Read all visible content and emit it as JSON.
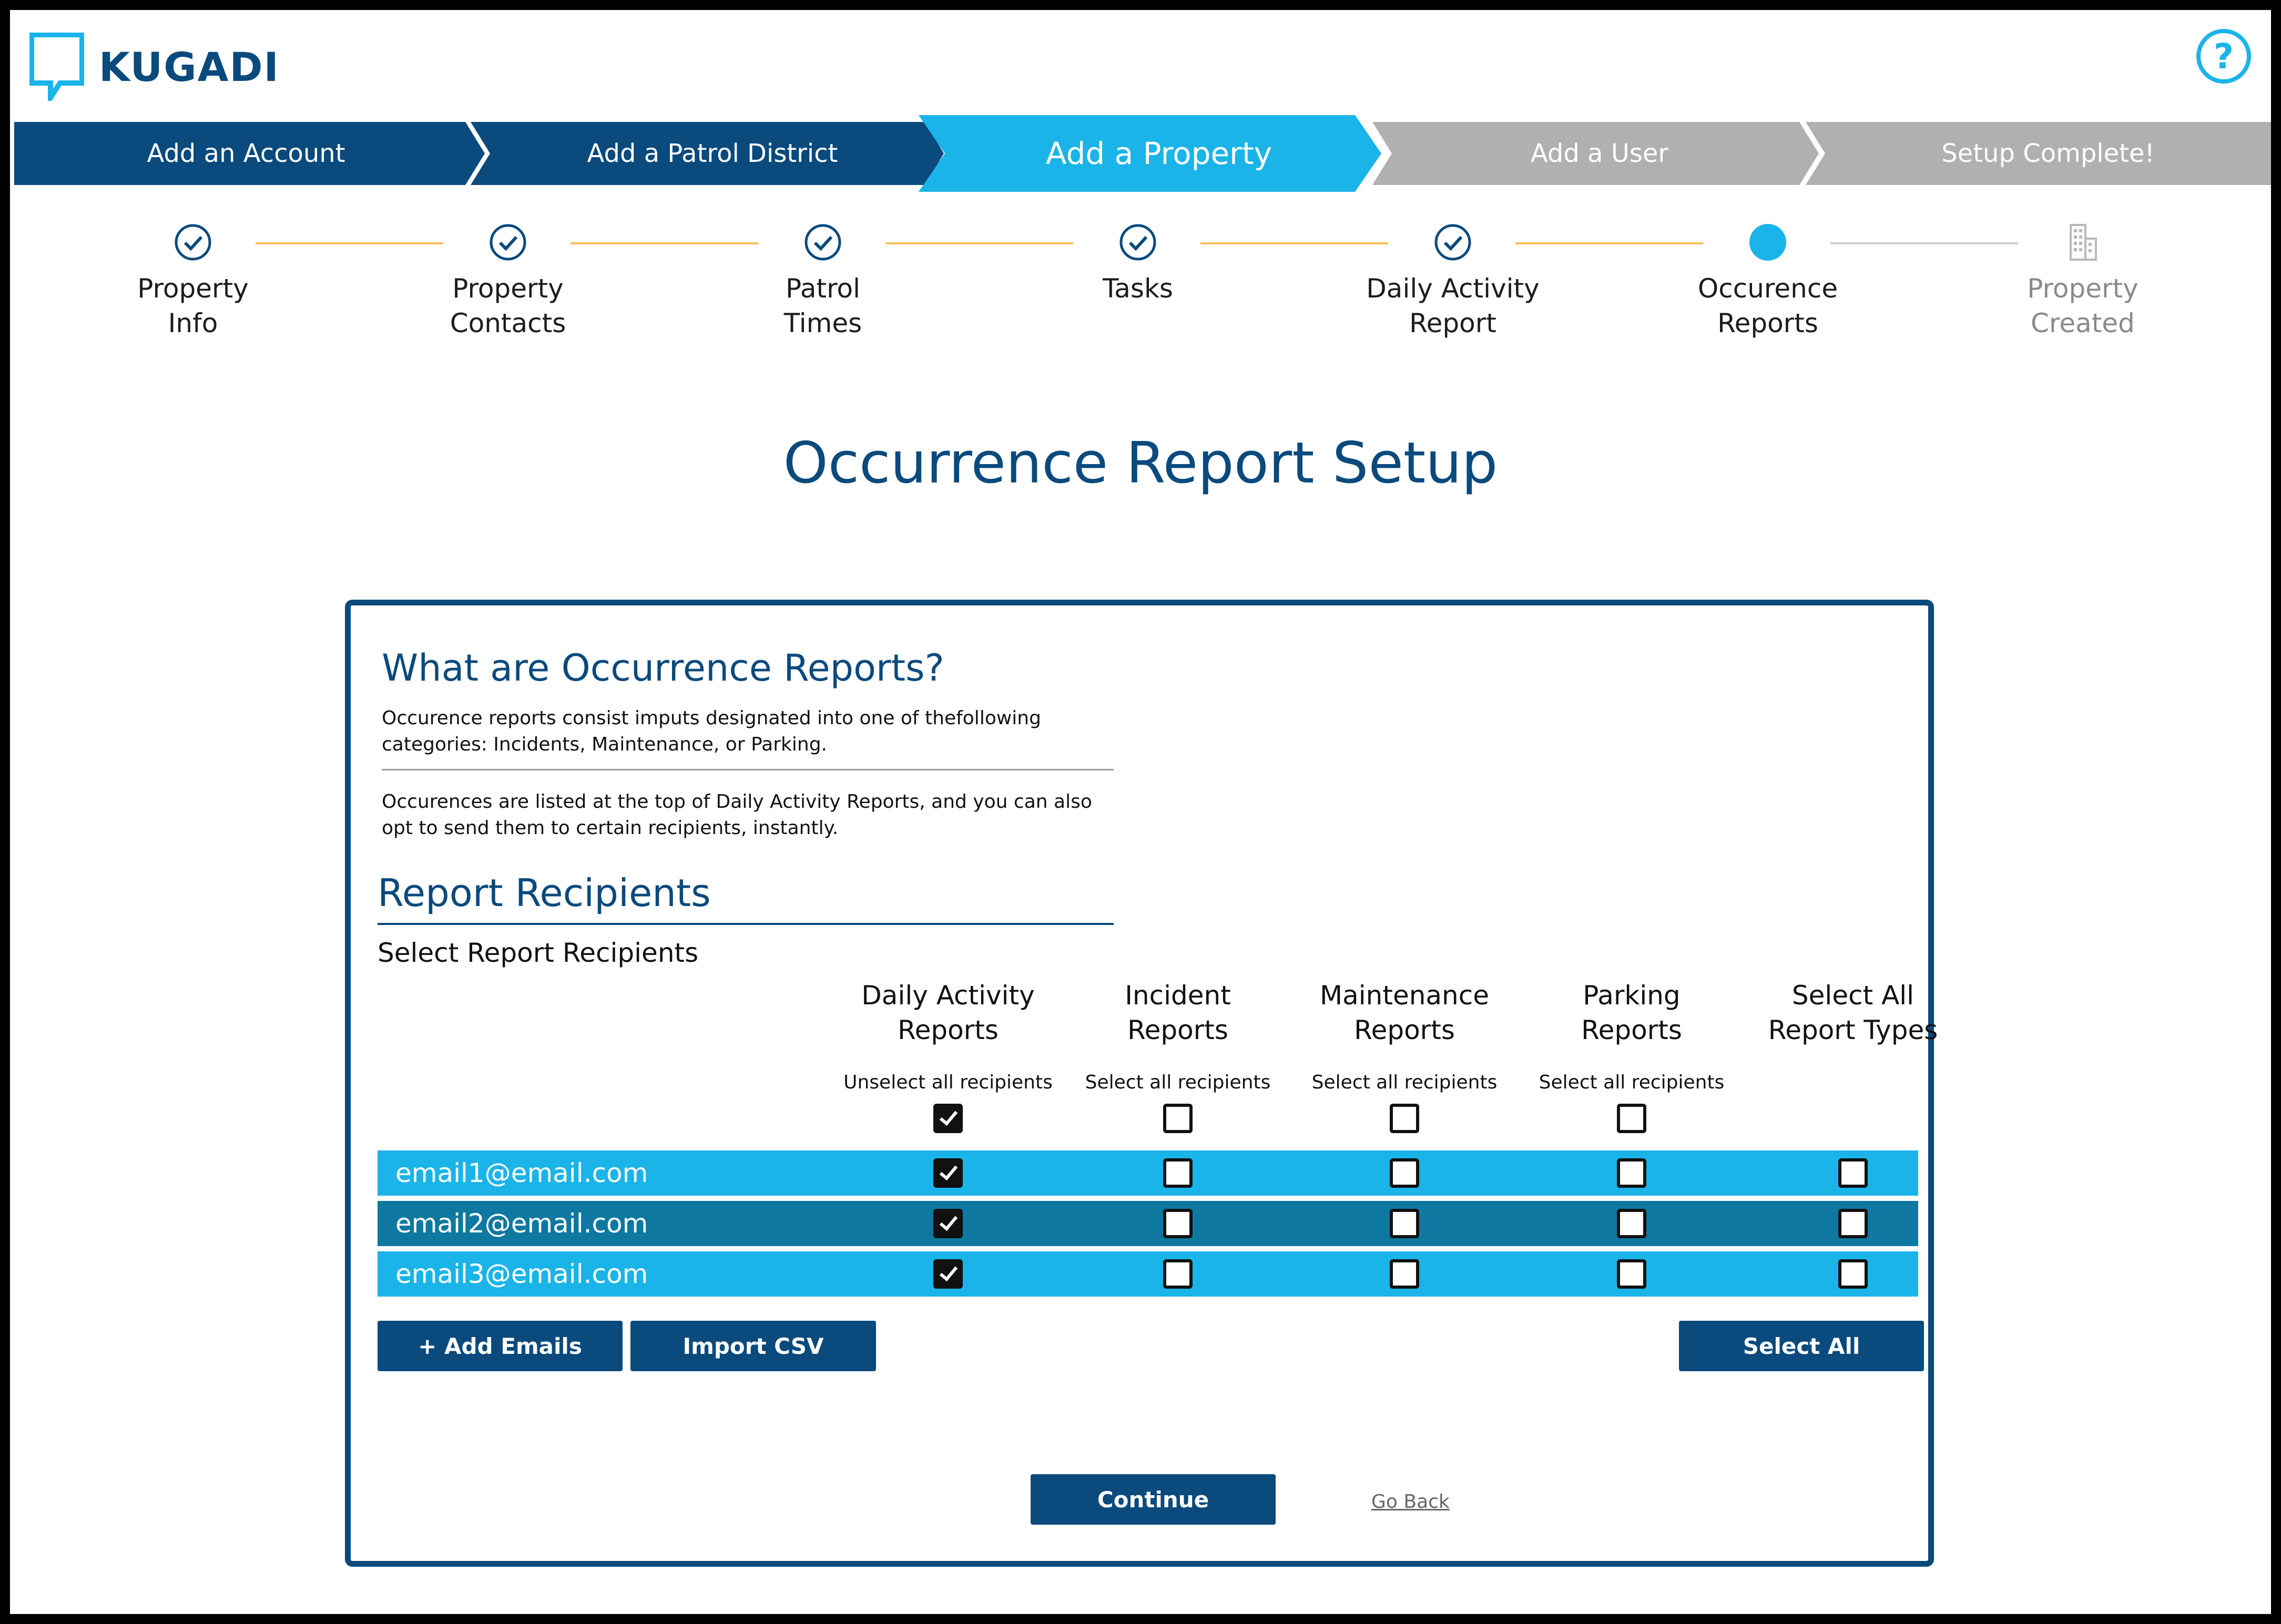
{
  "brand": {
    "name": "KUGADI"
  },
  "header": {
    "help_label": "?"
  },
  "wizard": [
    {
      "label": "Add an Account",
      "state": "done"
    },
    {
      "label": "Add a Patrol District",
      "state": "done"
    },
    {
      "label": "Add a Property",
      "state": "active"
    },
    {
      "label": "Add a User",
      "state": "pending"
    },
    {
      "label": "Setup Complete!",
      "state": "pending"
    }
  ],
  "substeps": [
    {
      "label": "Property\nInfo",
      "state": "done"
    },
    {
      "label": "Property\nContacts",
      "state": "done"
    },
    {
      "label": "Patrol\nTimes",
      "state": "done"
    },
    {
      "label": "Tasks",
      "state": "done"
    },
    {
      "label": "Daily Activity\nReport",
      "state": "done"
    },
    {
      "label": "Occurence\nReports",
      "state": "current"
    },
    {
      "label": "Property\nCreated",
      "state": "pending"
    }
  ],
  "page_title": "Occurrence Report Setup",
  "info": {
    "title": "What are Occurrence Reports?",
    "paragraph1": "Occurence reports consist imputs designated into one of thefollowing categories: Incidents, Maintenance, or Parking.",
    "paragraph2": "Occurences are listed at the top of Daily Activity Reports, and you can also opt to send them to certain recipients, instantly."
  },
  "recipients": {
    "title": "Report Recipients",
    "subtitle": "Select Report Recipients",
    "columns": [
      {
        "header": "Daily Activity\nReports",
        "select_text": "Unselect all recipients",
        "all_checked": true
      },
      {
        "header": "Incident\nReports",
        "select_text": "Select all recipients",
        "all_checked": false
      },
      {
        "header": "Maintenance\nReports",
        "select_text": "Select all recipients",
        "all_checked": false
      },
      {
        "header": "Parking\nReports",
        "select_text": "Select all recipients",
        "all_checked": false
      },
      {
        "header": "Select All\nReport Types",
        "select_text": "",
        "all_checked": null
      }
    ],
    "rows": [
      {
        "email": "email1@email.com",
        "checks": [
          true,
          false,
          false,
          false,
          false
        ]
      },
      {
        "email": "email2@email.com",
        "checks": [
          true,
          false,
          false,
          false,
          false
        ]
      },
      {
        "email": "email3@email.com",
        "checks": [
          true,
          false,
          false,
          false,
          false
        ]
      }
    ]
  },
  "buttons": {
    "add_emails": "+ Add Emails",
    "import_csv": "Import CSV",
    "select_all": "Select All",
    "continue": "Continue",
    "go_back": "Go Back"
  },
  "colors": {
    "navy": "#0a4a7d",
    "accent": "#1ab4e8",
    "row_alt": "#0e78a0",
    "pending_gray": "#b0b0b0",
    "line_done": "#f5c25a"
  }
}
